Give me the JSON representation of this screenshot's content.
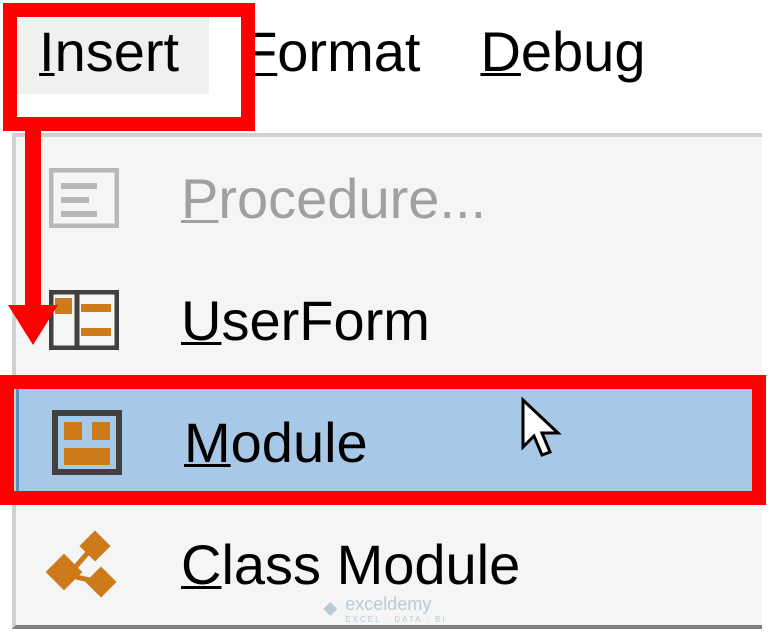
{
  "menubar": {
    "insert": "nsert",
    "insert_mnemonic": "I",
    "format": "ormat",
    "format_mnemonic": "F",
    "debug": "ebug",
    "debug_mnemonic": "D"
  },
  "dropdown": {
    "procedure": {
      "mnemonic": "P",
      "rest": "rocedure..."
    },
    "userform": {
      "mnemonic": "U",
      "rest": "serForm"
    },
    "module": {
      "mnemonic": "M",
      "rest": "odule"
    },
    "class_module": {
      "mnemonic": "C",
      "rest": "lass Module"
    }
  },
  "watermark": {
    "brand": "exceldemy",
    "sub": "EXCEL · DATA · BI"
  }
}
